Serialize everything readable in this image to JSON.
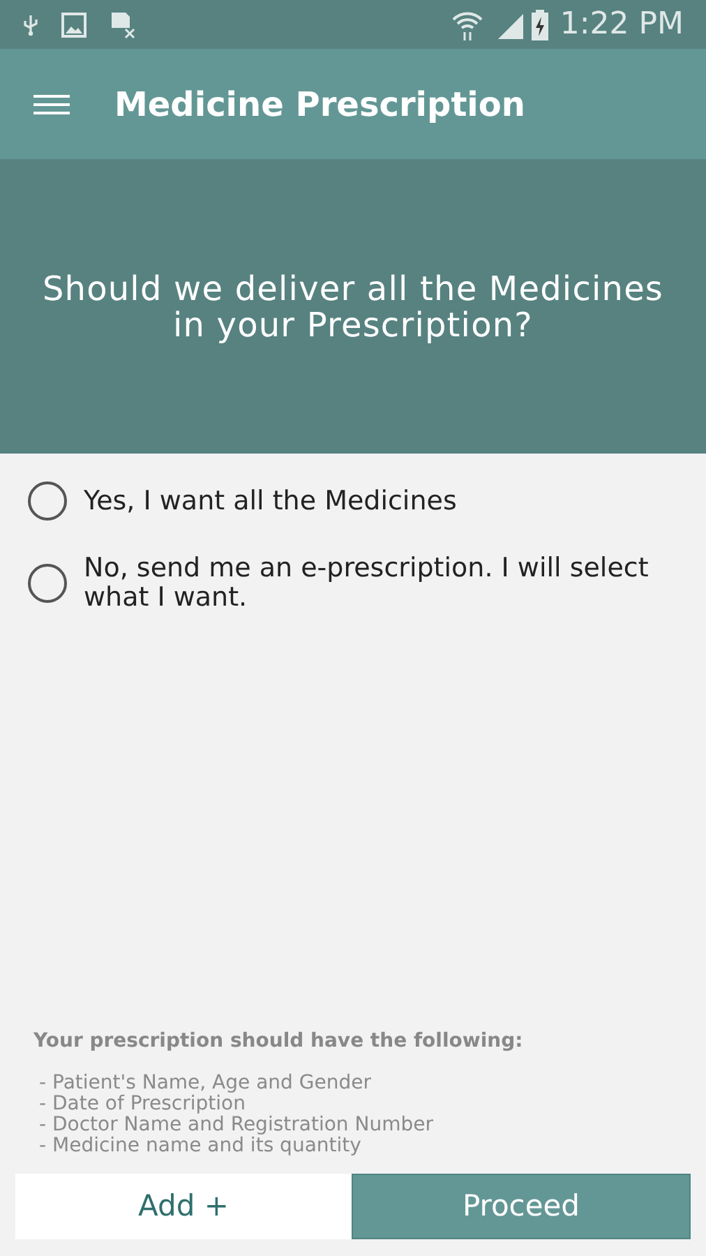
{
  "status_bar": {
    "time": "1:22 PM"
  },
  "app_bar": {
    "title": "Medicine Prescription"
  },
  "question": "Should we deliver all the Medicines in your Prescription?",
  "options": [
    {
      "label": "Yes, I want all the Medicines",
      "selected": false
    },
    {
      "label": "No, send me an e-prescription. I will select what I want.",
      "selected": false
    }
  ],
  "requirements": {
    "heading": "Your prescription should have the following:",
    "items": [
      "- Patient's Name, Age and Gender",
      "- Date of Prescription",
      "- Doctor Name and Registration Number",
      "- Medicine name and its quantity"
    ]
  },
  "buttons": [
    {
      "label": "Add +",
      "kind": "secondary"
    },
    {
      "label": "Proceed",
      "kind": "primary"
    }
  ]
}
